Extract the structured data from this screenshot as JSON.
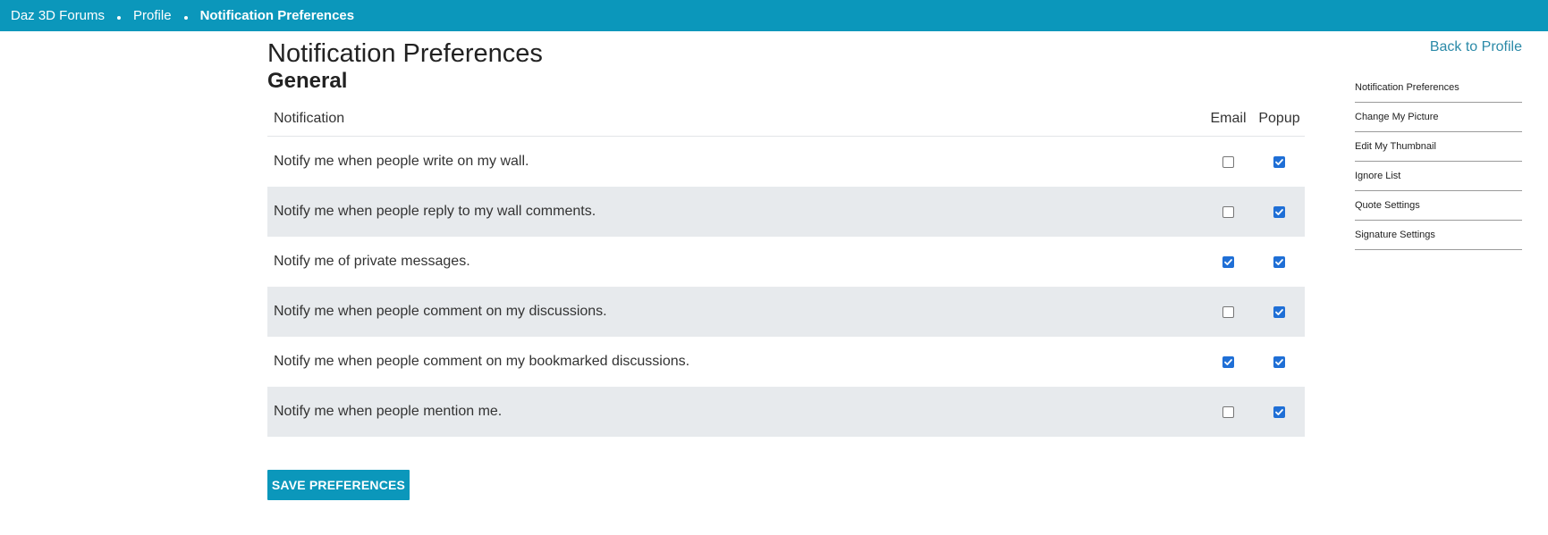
{
  "breadcrumb": {
    "items": [
      {
        "label": "Daz 3D Forums"
      },
      {
        "label": "Profile"
      },
      {
        "label": "Notification Preferences"
      }
    ]
  },
  "main": {
    "title": "Notification Preferences",
    "section": "General",
    "columns": {
      "notification": "Notification",
      "email": "Email",
      "popup": "Popup"
    },
    "rows": [
      {
        "label": "Notify me when people write on my wall.",
        "email": false,
        "popup": true
      },
      {
        "label": "Notify me when people reply to my wall comments.",
        "email": false,
        "popup": true
      },
      {
        "label": "Notify me of private messages.",
        "email": true,
        "popup": true
      },
      {
        "label": "Notify me when people comment on my discussions.",
        "email": false,
        "popup": true
      },
      {
        "label": "Notify me when people comment on my bookmarked discussions.",
        "email": true,
        "popup": true
      },
      {
        "label": "Notify me when people mention me.",
        "email": false,
        "popup": true
      }
    ],
    "save_label": "SAVE PREFERENCES"
  },
  "sidebar": {
    "back_label": "Back to Profile",
    "items": [
      {
        "label": "Notification Preferences"
      },
      {
        "label": "Change My Picture"
      },
      {
        "label": "Edit My Thumbnail"
      },
      {
        "label": "Ignore List"
      },
      {
        "label": "Quote Settings"
      },
      {
        "label": "Signature Settings"
      }
    ]
  },
  "colors": {
    "accent": "#0b97bb",
    "row_alt": "#e7eaed",
    "checkbox": "#1f6fd6"
  }
}
